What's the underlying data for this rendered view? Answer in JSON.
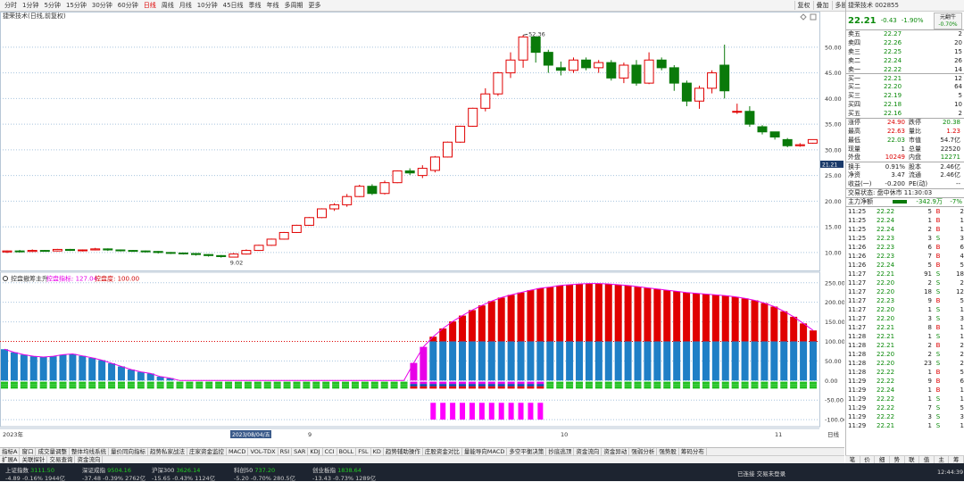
{
  "topbar": {
    "periods": [
      "分时",
      "1分钟",
      "5分钟",
      "15分钟",
      "30分钟",
      "60分钟",
      "日线",
      "周线",
      "月线",
      "10分钟",
      "45日线",
      "季线",
      "年线",
      "多周期",
      "更多"
    ],
    "period_selected": "日线",
    "tools": [
      "复权",
      "叠加",
      "多股",
      "统计",
      "画线",
      "F10",
      "标记",
      "-自选",
      "返回"
    ]
  },
  "main_chart": {
    "title": "捷荣技术(日线,前复权)",
    "high_label": "52.36",
    "low_label": "9.02",
    "current_tag": "21.21",
    "y_ticks": [
      10,
      15,
      20,
      25,
      30,
      35,
      40,
      45,
      50
    ],
    "ylim": [
      6.5,
      54.5
    ]
  },
  "sub_chart": {
    "title": "控盘撤筹主升",
    "legend": [
      {
        "label": "控盘指标: 127.04",
        "color": "#e800e8"
      },
      {
        "label": "控盘度: 100.00",
        "color": "#d00000"
      }
    ],
    "y_ticks": [
      -100,
      -50,
      0,
      50,
      100,
      150,
      200,
      250
    ],
    "ylim": [
      -118,
      270
    ]
  },
  "x_axis": {
    "labels": [
      "2023年",
      "9",
      "10",
      "11"
    ],
    "cursor_date": "2023/08/04/五",
    "right_label": "日线"
  },
  "chart_data": [
    {
      "type": "candlestick",
      "title": "捷荣技术(日线,前复权)",
      "candles": [
        [
          10.1,
          10.3,
          10.4,
          9.9
        ],
        [
          10.3,
          10.2,
          10.5,
          10.0
        ],
        [
          10.2,
          10.4,
          10.6,
          10.1
        ],
        [
          10.4,
          10.3,
          10.5,
          10.2
        ],
        [
          10.3,
          10.6,
          10.7,
          10.2
        ],
        [
          10.6,
          10.4,
          10.7,
          10.3
        ],
        [
          10.4,
          10.5,
          10.6,
          10.2
        ],
        [
          10.5,
          10.7,
          10.9,
          10.4
        ],
        [
          10.7,
          10.5,
          10.8,
          10.3
        ],
        [
          10.5,
          10.4,
          10.6,
          10.2
        ],
        [
          10.4,
          10.3,
          10.5,
          10.1
        ],
        [
          10.3,
          10.2,
          10.4,
          10.0
        ],
        [
          10.2,
          10.0,
          10.3,
          9.8
        ],
        [
          10.0,
          9.9,
          10.1,
          9.7
        ],
        [
          9.9,
          9.8,
          10.0,
          9.6
        ],
        [
          9.8,
          9.6,
          9.9,
          9.4
        ],
        [
          9.6,
          9.4,
          9.7,
          9.2
        ],
        [
          9.4,
          9.2,
          9.5,
          9.0
        ],
        [
          9.1,
          9.7,
          9.9,
          9.02
        ],
        [
          9.7,
          10.4,
          10.6,
          9.6
        ],
        [
          10.4,
          11.4,
          11.5,
          10.3
        ],
        [
          11.4,
          12.6,
          12.7,
          11.3
        ],
        [
          12.6,
          13.9,
          14.0,
          12.5
        ],
        [
          13.9,
          15.3,
          15.4,
          13.8
        ],
        [
          15.3,
          16.8,
          16.9,
          15.2
        ],
        [
          16.8,
          18.5,
          18.6,
          16.7
        ],
        [
          18.5,
          19.3,
          19.6,
          18.1
        ],
        [
          19.3,
          20.9,
          21.4,
          18.9
        ],
        [
          20.9,
          22.9,
          23.2,
          20.8
        ],
        [
          22.9,
          21.5,
          23.3,
          21.2
        ],
        [
          21.5,
          23.6,
          24.0,
          21.3
        ],
        [
          23.6,
          25.9,
          26.0,
          23.5
        ],
        [
          25.9,
          25.5,
          26.4,
          25.1
        ],
        [
          25.0,
          26.4,
          27.0,
          24.5
        ],
        [
          26.0,
          28.6,
          28.8,
          25.6
        ],
        [
          28.6,
          31.5,
          31.6,
          28.5
        ],
        [
          31.5,
          34.6,
          34.7,
          31.4
        ],
        [
          34.6,
          38.1,
          38.2,
          34.5
        ],
        [
          38.1,
          40.9,
          42.0,
          37.5
        ],
        [
          40.9,
          45.0,
          45.2,
          40.5
        ],
        [
          45.0,
          47.5,
          49.0,
          44.0
        ],
        [
          47.5,
          52.0,
          52.36,
          46.0
        ],
        [
          52.0,
          49.0,
          51.0,
          47.0
        ],
        [
          49.0,
          46.5,
          49.5,
          45.0
        ],
        [
          46.0,
          45.5,
          47.2,
          44.5
        ],
        [
          45.5,
          47.5,
          48.0,
          45.0
        ],
        [
          47.5,
          46.0,
          48.0,
          45.5
        ],
        [
          46.0,
          47.0,
          47.5,
          45.0
        ],
        [
          47.0,
          44.0,
          47.5,
          43.5
        ],
        [
          44.0,
          46.5,
          47.0,
          43.0
        ],
        [
          46.5,
          43.0,
          47.5,
          42.5
        ],
        [
          43.0,
          47.5,
          49.0,
          42.8
        ],
        [
          47.5,
          46.0,
          48.0,
          45.5
        ],
        [
          46.0,
          43.0,
          46.5,
          41.5
        ],
        [
          43.0,
          39.5,
          43.5,
          38.5
        ],
        [
          39.5,
          42.0,
          42.5,
          38.0
        ],
        [
          42.0,
          45.0,
          45.5,
          41.0
        ],
        [
          46.5,
          41.5,
          50.5,
          40.0
        ],
        [
          37.5,
          37.5,
          39.0,
          37.0
        ],
        [
          37.5,
          35.0,
          38.5,
          34.5
        ],
        [
          34.5,
          33.5,
          34.8,
          33.0
        ],
        [
          33.5,
          32.5,
          33.5,
          32.0
        ],
        [
          32.0,
          30.8,
          32.3,
          30.5
        ],
        [
          30.8,
          31.0,
          31.3,
          30.6
        ],
        [
          31.3,
          32.0,
          32.0,
          31.2
        ]
      ]
    },
    {
      "type": "bar",
      "title": "控盘撤筹主升",
      "series": [
        {
          "name": "控盘指标",
          "values": [
            80,
            72,
            66,
            62,
            60,
            62,
            66,
            68,
            63,
            58,
            52,
            44,
            36,
            28,
            22,
            18,
            10,
            6,
            0,
            0,
            0,
            0,
            0,
            0,
            0,
            0,
            0,
            0,
            0,
            0,
            0,
            0,
            0,
            0,
            0,
            0,
            0,
            0,
            0,
            0,
            0,
            0,
            45,
            86,
            112,
            133,
            151,
            166,
            180,
            192,
            203,
            212,
            219,
            225,
            231,
            236,
            239,
            243,
            245,
            247,
            248,
            248,
            247,
            245,
            243,
            240,
            237,
            234,
            231,
            228,
            225,
            223,
            221,
            219,
            217,
            214,
            210,
            205,
            198,
            189,
            177,
            163,
            146,
            128
          ]
        },
        {
          "name": "控盘度",
          "values": [
            0,
            0,
            0,
            0,
            0,
            0,
            0,
            0,
            0,
            0,
            0,
            0,
            0,
            0,
            0,
            0,
            0,
            0,
            0,
            0,
            0,
            0,
            0,
            0,
            0,
            0,
            0,
            0,
            0,
            0,
            0,
            0,
            0,
            0,
            0,
            0,
            0,
            0,
            0,
            0,
            0,
            0,
            0,
            0,
            100,
            100,
            100,
            100,
            100,
            100,
            100,
            100,
            100,
            100,
            100,
            100,
            100,
            100,
            100,
            100,
            100,
            100,
            100,
            100,
            100,
            100,
            100,
            100,
            100,
            100,
            100,
            100,
            100,
            100,
            100,
            100,
            100,
            100,
            100,
            100,
            100,
            100,
            100,
            100
          ]
        }
      ]
    }
  ],
  "quote": {
    "title": "捷荣技术 002855",
    "price": "22.21",
    "change": "-0.43",
    "pct": "-1.90%",
    "badge_top": "元翻牛",
    "badge_bot": "-0.70%",
    "asks": [
      {
        "label": "卖五",
        "price": "22.27",
        "vol": "2"
      },
      {
        "label": "卖四",
        "price": "22.26",
        "vol": "20"
      },
      {
        "label": "卖三",
        "price": "22.25",
        "vol": "15"
      },
      {
        "label": "卖二",
        "price": "22.24",
        "vol": "26"
      },
      {
        "label": "卖一",
        "price": "22.22",
        "vol": "14"
      }
    ],
    "bids": [
      {
        "label": "买一",
        "price": "22.21",
        "vol": "12"
      },
      {
        "label": "买二",
        "price": "22.20",
        "vol": "64"
      },
      {
        "label": "买三",
        "price": "22.19",
        "vol": "5"
      },
      {
        "label": "买四",
        "price": "22.18",
        "vol": "10"
      },
      {
        "label": "买五",
        "price": "22.16",
        "vol": "2"
      }
    ],
    "stats1": [
      [
        "涨停",
        "24.90",
        "跌停",
        "20.38"
      ],
      [
        "最高",
        "22.63",
        "量比",
        "1.23"
      ],
      [
        "最低",
        "22.03",
        "市值",
        "54.7亿"
      ],
      [
        "现量",
        "1",
        "总量",
        "22520"
      ],
      [
        "外盘",
        "10249",
        "内盘",
        "12271"
      ]
    ],
    "stats2": [
      [
        "换手",
        "0.91%",
        "股本",
        "2.46亿"
      ],
      [
        "净资",
        "3.47",
        "流通",
        "2.46亿"
      ],
      [
        "收益(一)",
        "-0.200",
        "PE(动)",
        "--"
      ]
    ],
    "status_line": "交易状态: 盘中休市 11:30:03",
    "netflow_label": "主力净额",
    "netflow_value": "-342.9万",
    "netflow_pct": "-7%",
    "ticks": [
      [
        "11:25",
        "22.22",
        "5",
        "B",
        "2"
      ],
      [
        "11:25",
        "22.24",
        "1",
        "B",
        "1"
      ],
      [
        "11:25",
        "22.24",
        "2",
        "B",
        "1"
      ],
      [
        "11:25",
        "22.23",
        "3",
        "S",
        "3"
      ],
      [
        "11:26",
        "22.23",
        "6",
        "B",
        "6"
      ],
      [
        "11:26",
        "22.23",
        "7",
        "B",
        "4"
      ],
      [
        "11:26",
        "22.24",
        "5",
        "B",
        "5"
      ],
      [
        "11:27",
        "22.21",
        "91",
        "S",
        "18"
      ],
      [
        "11:27",
        "22.20",
        "2",
        "S",
        "2"
      ],
      [
        "11:27",
        "22.20",
        "18",
        "S",
        "12"
      ],
      [
        "11:27",
        "22.23",
        "9",
        "B",
        "5"
      ],
      [
        "11:27",
        "22.20",
        "1",
        "S",
        "1"
      ],
      [
        "11:27",
        "22.20",
        "3",
        "S",
        "3"
      ],
      [
        "11:27",
        "22.21",
        "8",
        "B",
        "1"
      ],
      [
        "11:28",
        "22.21",
        "1",
        "S",
        "1"
      ],
      [
        "11:28",
        "22.21",
        "2",
        "B",
        "2"
      ],
      [
        "11:28",
        "22.20",
        "2",
        "S",
        "2"
      ],
      [
        "11:28",
        "22.20",
        "23",
        "S",
        "2"
      ],
      [
        "11:28",
        "22.22",
        "1",
        "B",
        "5"
      ],
      [
        "11:29",
        "22.22",
        "9",
        "B",
        "6"
      ],
      [
        "11:29",
        "22.24",
        "1",
        "B",
        "1"
      ],
      [
        "11:29",
        "22.22",
        "1",
        "S",
        "1"
      ],
      [
        "11:29",
        "22.22",
        "7",
        "S",
        "5"
      ],
      [
        "11:29",
        "22.22",
        "3",
        "S",
        "3"
      ],
      [
        "11:29",
        "22.21",
        "1",
        "S",
        "1"
      ]
    ]
  },
  "bottom_tabs": [
    "指标A",
    "窗口",
    "成交量调整",
    "整体均线系统",
    "量价同向指标",
    "趋势私家战法",
    "庄家资金监控",
    "MACD",
    "VOL-TDX",
    "RSI",
    "SAR",
    "KDJ",
    "CCI",
    "BOLL",
    "FSL",
    "KD",
    "趋势辅助操作",
    "庄股资金对比",
    "量能导向MACD",
    "多空平衡决策",
    "抄底逃顶",
    "资金流向",
    "资金异动",
    "强弱分析",
    "强势股",
    "筹码分布"
  ],
  "bottom_tabs2": [
    "扩展A",
    "关联探针",
    "交易查询",
    "资金流向"
  ],
  "right_tabs": [
    "笔",
    "价",
    "细",
    "势",
    "联",
    "值",
    "主",
    "筹"
  ],
  "status_bar": {
    "indices": [
      {
        "name": "上证指数",
        "value": "3111.50",
        "chg": "-4.89",
        "pct": "-0.16%",
        "amt": "1944亿"
      },
      {
        "name": "深证成指",
        "value": "9504.16",
        "chg": "-37.48",
        "pct": "-0.39%",
        "amt": "2762亿"
      },
      {
        "name": "沪深300",
        "value": "3626.14",
        "chg": "-15.65",
        "pct": "-0.43%",
        "amt": "1124亿"
      },
      {
        "name": "科创50",
        "value": "737.20",
        "chg": "-5.20",
        "pct": "-0.70%",
        "amt": "280.5亿"
      },
      {
        "name": "创业板指",
        "value": "1838.64",
        "chg": "-13.43",
        "pct": "-0.73%",
        "amt": "1289亿"
      }
    ],
    "connection": "已连接 交易未登录",
    "time": "12:44:39"
  },
  "colors": {
    "up": "#e00000",
    "down": "#0a7a0a",
    "accent": "#e800e8",
    "blue_bar": "#1f7fc6"
  }
}
